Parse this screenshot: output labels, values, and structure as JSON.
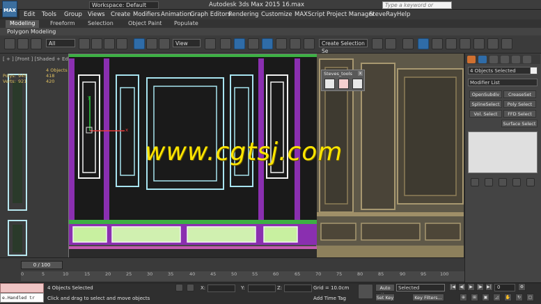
{
  "app": {
    "logo_text": "MAX",
    "workspace": "Workspace: Default",
    "title": "Autodesk 3ds Max  2015     16.max",
    "search_placeholder": "Type a keyword or phrase"
  },
  "menu": [
    "Edit",
    "Tools",
    "Group",
    "Views",
    "Create",
    "Modifiers",
    "Animation",
    "Graph Editors",
    "Rendering",
    "Customize",
    "MAXScript",
    "Project Manager",
    "SteveRay",
    "Help"
  ],
  "ribbon": {
    "tabs": [
      "Modeling",
      "Freeform",
      "Selection",
      "Object Paint",
      "Populate"
    ],
    "sub_label": "Polygon Modeling"
  },
  "toolbar": {
    "filter": "All",
    "ref_coord": "View",
    "named_selection": "Create Selection Se"
  },
  "viewport": {
    "label": "[ + ] [Front ] [Shaded + Edged Faces ]",
    "stats_header": "4 Objects Selected",
    "stats_rows": [
      {
        "label": "Polys:",
        "a": "945",
        "b": "418"
      },
      {
        "label": "Verts:",
        "a": "921",
        "b": "420"
      }
    ],
    "axis_x": "x",
    "axis_y": "y"
  },
  "steves_tools": {
    "title": "Steves_tools",
    "close": "x"
  },
  "watermark": "www.cgtsj.com",
  "command_panel": {
    "selection": "4 Objects Selected",
    "modifier_list": "Modifier List",
    "buttons": [
      "OpenSubdiv",
      "CreaseSet",
      "SplineSelect",
      "Poly Select",
      "Vol. Select",
      "FFD Select",
      "Surface Select"
    ]
  },
  "timeline": {
    "slider": "0 / 100",
    "ticks": [
      "0",
      "5",
      "10",
      "15",
      "20",
      "25",
      "30",
      "35",
      "40",
      "45",
      "50",
      "55",
      "60",
      "65",
      "70",
      "75",
      "80",
      "85",
      "90",
      "95",
      "100"
    ]
  },
  "status": {
    "script_text": "e.Handled tr",
    "objects_selected": "4 Objects Selected",
    "hint": "Click and drag to select and move objects",
    "x_label": "X:",
    "y_label": "Y:",
    "z_label": "Z:",
    "grid": "Grid = 10.0cm",
    "add_time_tag": "Add Time Tag",
    "auto_key": "Auto Key",
    "set_key": "Set Key",
    "key_filter_value": "Selected",
    "key_filters": "Key Filters...",
    "frame": "0"
  }
}
